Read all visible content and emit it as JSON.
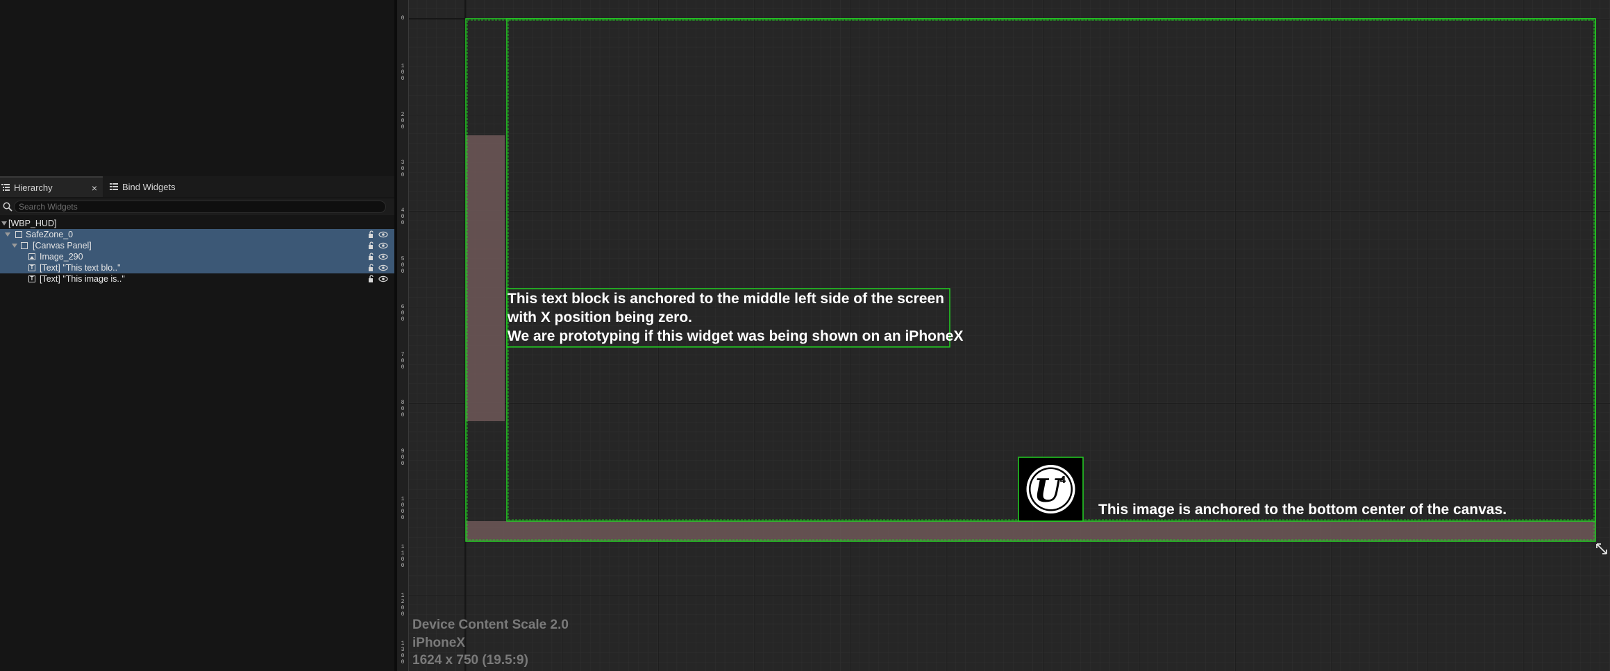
{
  "hierarchy_panel": {
    "tabs": [
      {
        "label": "Hierarchy",
        "active": true
      },
      {
        "label": "Bind Widgets",
        "active": false
      }
    ],
    "close_glyph": "×",
    "search": {
      "placeholder": "Search Widgets",
      "value": ""
    },
    "tree": [
      {
        "label": "[WBP_HUD]",
        "selected": false,
        "expanded": true
      },
      {
        "label": "SafeZone_0",
        "selected": true,
        "expanded": true,
        "icon": "safezone-icon"
      },
      {
        "label": "[Canvas Panel]",
        "selected": true,
        "expanded": true,
        "icon": "canvas-panel-icon"
      },
      {
        "label": "Image_290",
        "selected": true,
        "icon": "image-widget-icon"
      },
      {
        "label": "[Text] \"This text blo..\"",
        "selected": true,
        "icon": "text-widget-icon",
        "icon_glyph": "T"
      },
      {
        "label": "[Text] \"This image is..\"",
        "selected": false,
        "icon": "text-widget-icon",
        "icon_glyph": "T"
      }
    ]
  },
  "ruler": {
    "labels": [
      "0",
      "100",
      "200",
      "300",
      "400",
      "500",
      "600",
      "700",
      "800",
      "900",
      "1000",
      "1100",
      "1200",
      "1300"
    ]
  },
  "canvas": {
    "text_block_1": {
      "lines": [
        "This text block is anchored to the middle left side of the screen",
        "with X position being zero.",
        "We are prototyping if this widget was being shown on an iPhoneX"
      ]
    },
    "image_text": "This image is anchored to the bottom center of the canvas.",
    "logo_glyph": "U",
    "logo_superscript": "4"
  },
  "device_info": {
    "scale": "Device Content Scale 2.0",
    "device": "iPhoneX",
    "resolution": "1624 x 750 (19.5:9)"
  },
  "colors": {
    "selection_outline": "#22d022",
    "safe_zone_overlay": "#6e5858",
    "row_selected": "#3c5876",
    "canvas_bg": "#262626"
  }
}
